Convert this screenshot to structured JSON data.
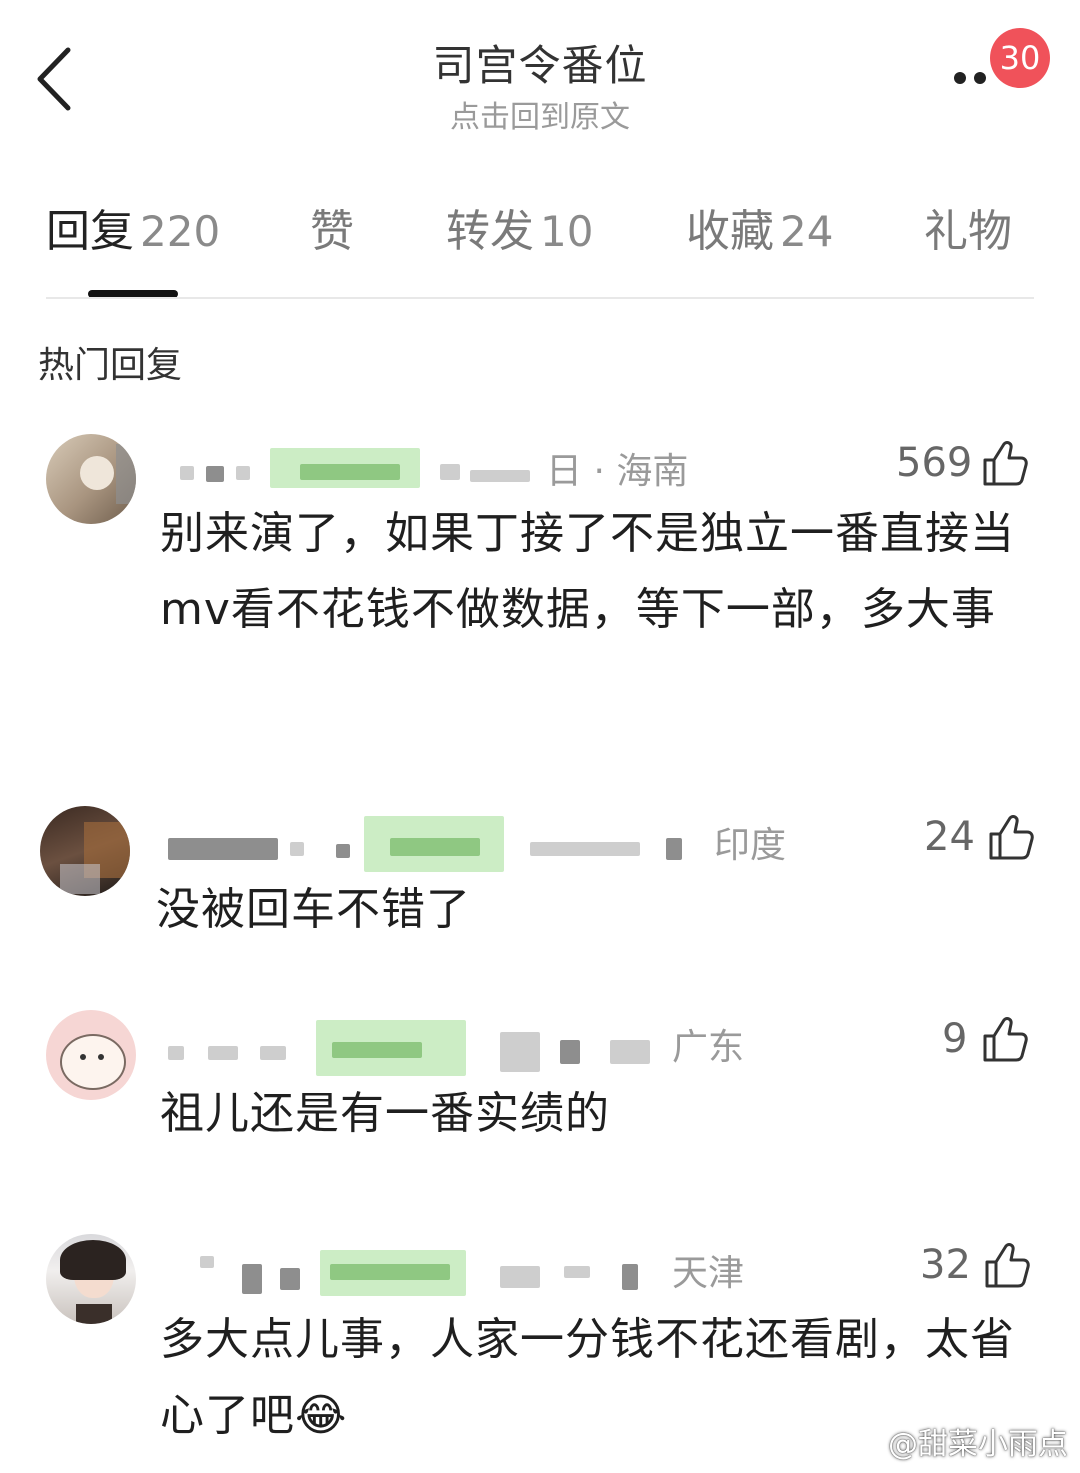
{
  "header": {
    "title": "司宫令番位",
    "subtitle": "点击回到原文",
    "badge_count": "30",
    "accent_color": "#f0525a"
  },
  "tabs": [
    {
      "label": "回复",
      "count": "220"
    },
    {
      "label": "赞",
      "count": ""
    },
    {
      "label": "转发",
      "count": "10"
    },
    {
      "label": "收藏",
      "count": "24"
    },
    {
      "label": "礼物",
      "count": ""
    }
  ],
  "section": {
    "title": "热门回复"
  },
  "comments": [
    {
      "location": "日 · 海南",
      "likes": "569",
      "text": "别来演了，如果丁接了不是独立一番直接当mv看不花钱不做数据，等下一部，多大事"
    },
    {
      "location": "印度",
      "likes": "24",
      "text": "没被回车不错了"
    },
    {
      "location": "广东",
      "likes": "9",
      "text": "祖儿还是有一番实绩的"
    },
    {
      "location": "天津",
      "likes": "32",
      "text": "多大点儿事，人家一分钱不花还看剧，太省心了吧😂"
    }
  ],
  "watermark": "@甜菜小雨点",
  "icons": [
    "back-arrow-icon",
    "more-icon",
    "like-icon",
    "avatar"
  ]
}
